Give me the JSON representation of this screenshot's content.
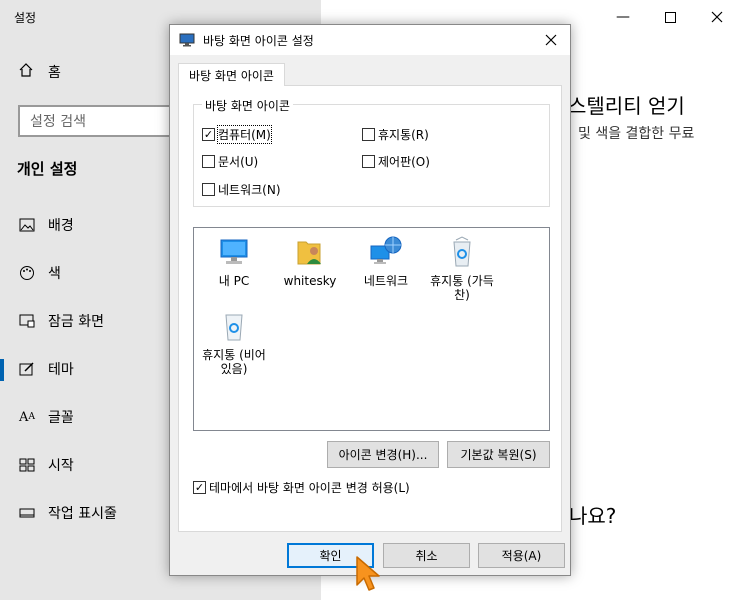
{
  "settings": {
    "title": "설정",
    "home_label": "홈",
    "search_placeholder": "설정 검색",
    "section_title": "개인 설정",
    "nav_items": [
      {
        "label": "배경",
        "icon": "image-icon"
      },
      {
        "label": "색",
        "icon": "palette-icon"
      },
      {
        "label": "잠금 화면",
        "icon": "lock-screen-icon"
      },
      {
        "label": "테마",
        "icon": "theme-icon"
      },
      {
        "label": "글꼴",
        "icon": "font-icon"
      },
      {
        "label": "시작",
        "icon": "start-icon"
      },
      {
        "label": "작업 표시줄",
        "icon": "taskbar-icon"
      }
    ],
    "active_item": "테마",
    "right_text1": "스텔리티 얻기",
    "right_text2": "및 색을 결합한 무료",
    "right_text3": "나요?"
  },
  "dialog": {
    "title": "바탕 화면 아이콘 설정",
    "tab_label": "바탕 화면 아이콘",
    "group_label": "바탕 화면 아이콘",
    "checkboxes": {
      "computer": {
        "label": "컴퓨터(M)",
        "checked": true
      },
      "recycle": {
        "label": "휴지통(R)",
        "checked": false
      },
      "documents": {
        "label": "문서(U)",
        "checked": false
      },
      "control": {
        "label": "제어판(O)",
        "checked": false
      },
      "network": {
        "label": "네트워크(N)",
        "checked": false
      }
    },
    "icons": {
      "pc": "내 PC",
      "user": "whitesky",
      "net": "네트워크",
      "full": "휴지통 (가득 찬)",
      "empty": "휴지통 (비어 있음)"
    },
    "change_icon_button": "아이콘 변경(H)...",
    "restore_default_button": "기본값 복원(S)",
    "allow_themes_label": "테마에서 바탕 화면 아이콘 변경 허용(L)",
    "allow_themes_checked": true,
    "ok_button": "확인",
    "cancel_button": "취소",
    "apply_button": "적용(A)"
  },
  "colors": {
    "accent": "#0078d7",
    "cursor": "#f7931e"
  }
}
